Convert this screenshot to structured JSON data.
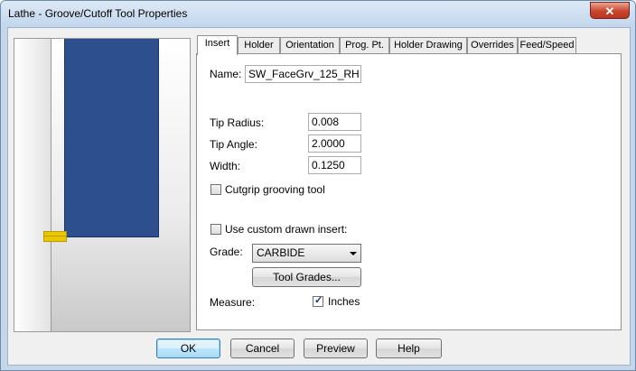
{
  "window": {
    "title": "Lathe - Groove/Cutoff Tool Properties",
    "close_glyph": "✕"
  },
  "tabs": [
    {
      "label": "Insert",
      "active": true
    },
    {
      "label": "Holder"
    },
    {
      "label": "Orientation"
    },
    {
      "label": "Prog. Pt."
    },
    {
      "label": "Holder Drawing"
    },
    {
      "label": "Overrides"
    },
    {
      "label": "Feed/Speed"
    }
  ],
  "insert": {
    "name_label": "Name:",
    "name_value": "SW_FaceGrv_125_RH",
    "tip_radius_label": "Tip Radius:",
    "tip_radius_value": "0.008",
    "tip_angle_label": "Tip Angle:",
    "tip_angle_value": "2.0000",
    "width_label": "Width:",
    "width_value": "0.1250",
    "cutgrip_label": "Cutgrip grooving tool",
    "cutgrip_checked": false,
    "custom_insert_label": "Use custom drawn insert:",
    "custom_insert_checked": false,
    "grade_label": "Grade:",
    "grade_value": "CARBIDE",
    "tool_grades_button": "Tool Grades...",
    "measure_label": "Measure:",
    "inches_label": "Inches",
    "inches_checked": true
  },
  "buttons": {
    "ok": "OK",
    "cancel": "Cancel",
    "preview": "Preview",
    "help": "Help"
  },
  "colors": {
    "tool_body": "#2e4f8e",
    "insert_tip": "#e8c800",
    "title_bar": "#c4d6ea",
    "close": "#c8462e"
  }
}
